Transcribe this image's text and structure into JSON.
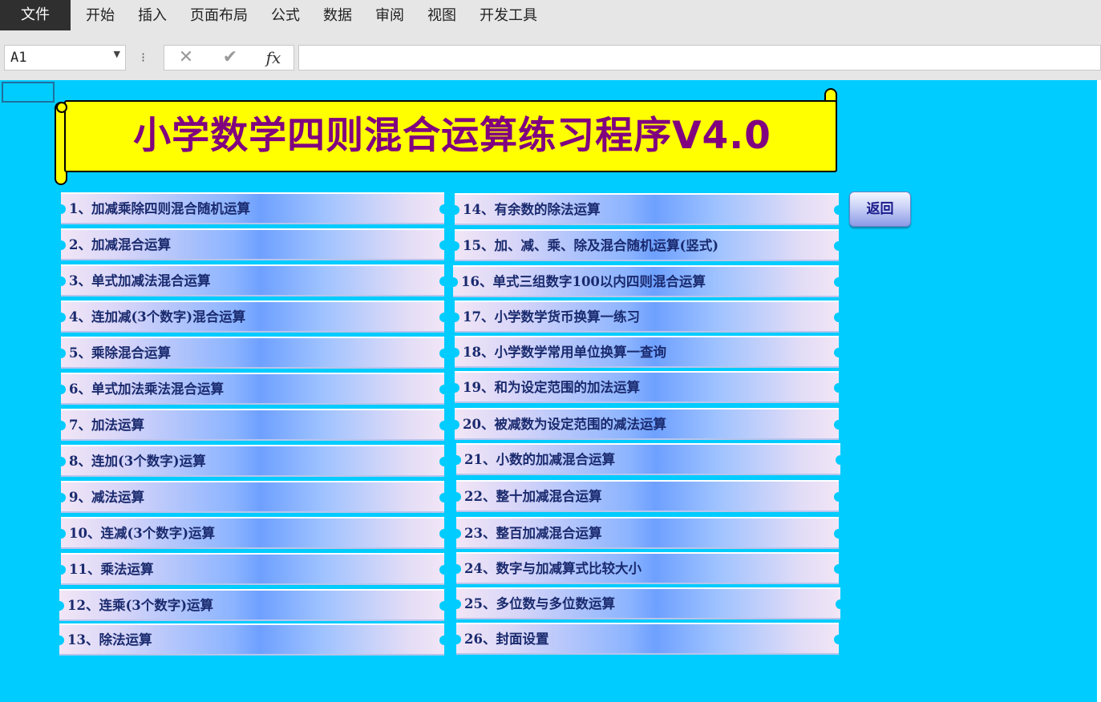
{
  "menu": {
    "file": "文件",
    "tabs": [
      "开始",
      "插入",
      "页面布局",
      "公式",
      "数据",
      "审阅",
      "视图",
      "开发工具"
    ]
  },
  "formula_bar": {
    "name_box": "A1",
    "separator": "⁝",
    "cancel_glyph": "✕",
    "enter_glyph": "✔",
    "fx_label": "fx",
    "formula": ""
  },
  "sheet": {
    "background_color": "#00ccff",
    "title": "小学数学四则混合运算练习程序V4.0",
    "title_color": "#800080",
    "banner_color": "#ffff00",
    "back_button": "返回",
    "left_items": [
      "1、加减乘除四则混合随机运算",
      "2、加减混合运算",
      "3、单式加减法混合运算",
      "4、连加减(3个数字)混合运算",
      "5、乘除混合运算",
      "6、单式加法乘法混合运算",
      "7、加法运算",
      "8、连加(3个数字)运算",
      "9、减法运算",
      "10、连减(3个数字)运算",
      "11、乘法运算",
      "12、连乘(3个数字)运算",
      "13、除法运算"
    ],
    "right_items": [
      "14、有余数的除法运算",
      "15、加、减、乘、除及混合随机运算(竖式)",
      "16、单式三组数字100以内四则混合运算",
      "17、小学数学货币换算一练习",
      "18、小学数学常用单位换算一查询",
      "19、和为设定范围的加法运算",
      "20、被减数为设定范围的减法运算",
      "21、小数的加减混合运算",
      "22、整十加减混合运算",
      "23、整百加减混合运算",
      "24、数字与加减算式比较大小",
      "25、多位数与多位数运算",
      "26、封面设置"
    ]
  }
}
